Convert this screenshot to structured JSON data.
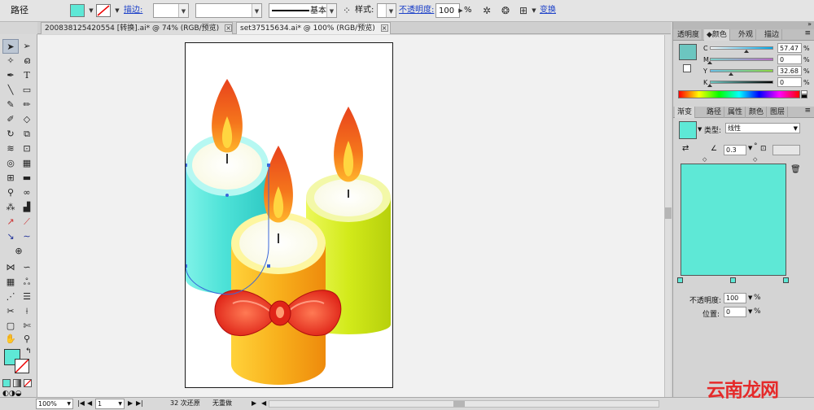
{
  "control_bar": {
    "object_type": "路径",
    "fill_color": "#5ee8d6",
    "stroke_label": "描边:",
    "stroke_weight": "",
    "stroke_style": "基本",
    "style_label": "样式:",
    "opacity_label": "不透明度:",
    "opacity_value": "100",
    "opacity_unit": "%",
    "transform_label": "变换"
  },
  "tabs": [
    {
      "label": "200838125420554 [转换].ai* @ 74% (RGB/预览)",
      "close": "×"
    },
    {
      "label": "set37515634.ai* @ 100% (RGB/预览)",
      "close": "×"
    }
  ],
  "color_panel": {
    "tabs": [
      "透明度",
      "颜色",
      "外观",
      "描边"
    ],
    "active_tab": "颜色",
    "fill_color": "#6cc6c0",
    "channels": [
      {
        "label": "C",
        "value": "57.47",
        "unit": "%",
        "level": 0.57
      },
      {
        "label": "M",
        "value": "0",
        "unit": "%",
        "level": 0
      },
      {
        "label": "Y",
        "value": "32.68",
        "unit": "%",
        "level": 0.33
      },
      {
        "label": "K",
        "value": "0",
        "unit": "%",
        "level": 0
      }
    ]
  },
  "gradient_panel": {
    "tabs": [
      "渐变",
      "路径",
      "属性",
      "颜色",
      "图层"
    ],
    "active_tab": "渐变",
    "type_label": "类型:",
    "type_value": "线性",
    "angle_value": "0.3",
    "angle_unit": "°",
    "gradient_color": "#5ee8d6",
    "opacity_label": "不透明度:",
    "opacity_value": "100",
    "opacity_unit": "%",
    "position_label": "位置:",
    "position_value": "0",
    "position_unit": "%"
  },
  "status_bar": {
    "zoom": "100%",
    "artboard": "1",
    "undo_count": "32 次还原",
    "redo": "无重做"
  },
  "watermark": "云南龙网",
  "tool_fill_color": "#5ee8d6",
  "artwork": {
    "cyan_candle": "#4ee3d8",
    "orange_candle": "#f8b01c",
    "green_candle": "#d2ea1a",
    "bow_color": "#e8261c",
    "flame_outer": "#e8421c",
    "flame_inner": "#ffd640"
  }
}
